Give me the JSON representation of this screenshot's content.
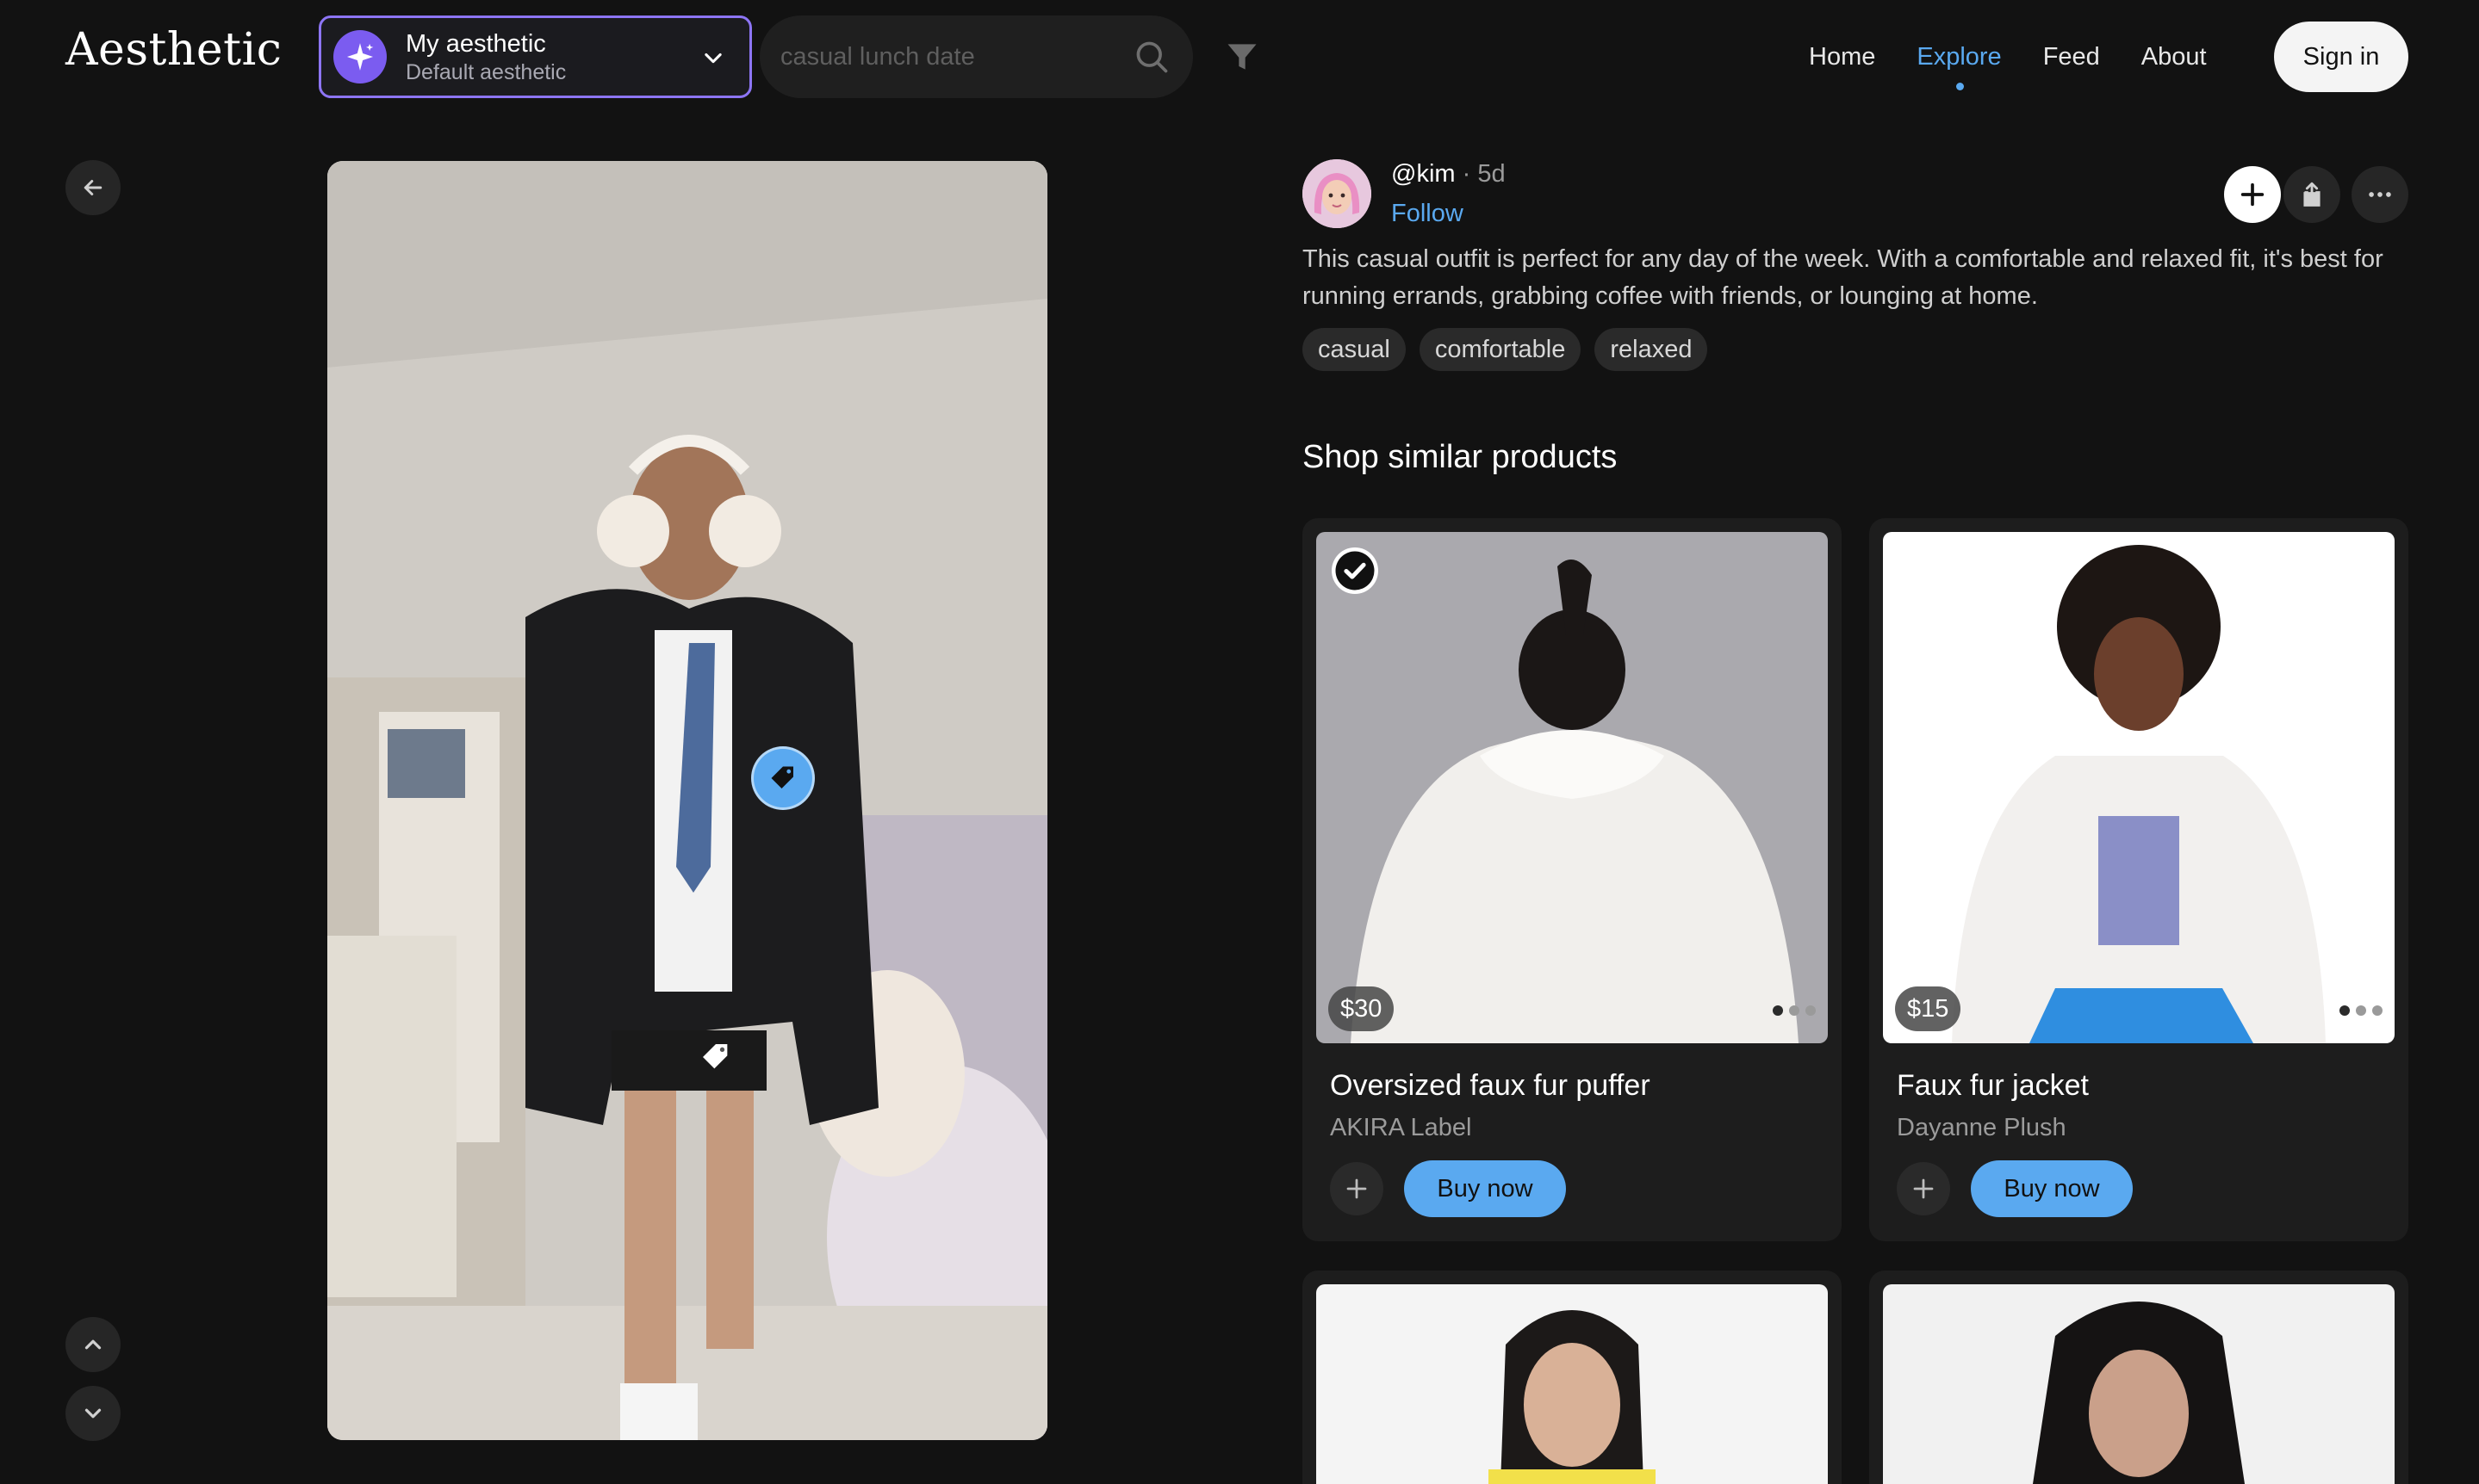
{
  "app": {
    "logo": "Aesthetic"
  },
  "aesthetic_selector": {
    "title": "My aesthetic",
    "subtitle": "Default aesthetic"
  },
  "search": {
    "placeholder": "casual lunch date",
    "value": ""
  },
  "nav": {
    "items": [
      "Home",
      "Explore",
      "Feed",
      "About"
    ],
    "active": "Explore"
  },
  "header": {
    "signin_label": "Sign in"
  },
  "post": {
    "username": "@kim",
    "age": "5d",
    "follow_label": "Follow",
    "description": "This casual outfit is perfect for any day of the week. With a comfortable and relaxed fit, it's best for running errands, grabbing coffee with friends, or lounging at home.",
    "tags": [
      "casual",
      "comfortable",
      "relaxed"
    ]
  },
  "shop": {
    "title": "Shop similar products",
    "products": [
      {
        "name": "Oversized faux fur puffer",
        "brand": "AKIRA Label",
        "price": "$30",
        "buy_label": "Buy now",
        "saved": true
      },
      {
        "name": "Faux fur jacket",
        "brand": "Dayanne Plush",
        "price": "$15",
        "buy_label": "Buy now",
        "saved": false
      }
    ]
  },
  "colors": {
    "accent": "#5aa9f0",
    "purple": "#8d75f5",
    "background": "#121212",
    "card": "#1d1d1d"
  }
}
